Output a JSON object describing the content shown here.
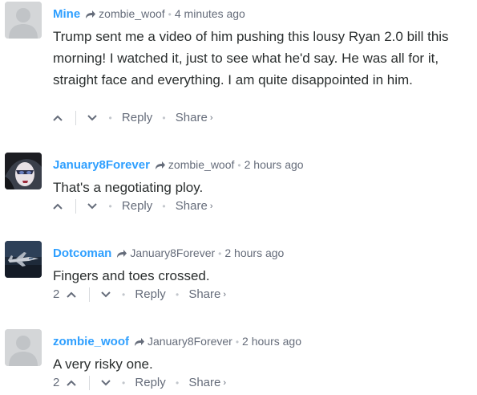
{
  "comments": [
    {
      "author": "Mine",
      "parent": "zombie_woof",
      "time": "4 minutes ago",
      "text": "Trump sent me a video of him pushing this lousy Ryan 2.0 bill this morning! I watched it, just to see what he'd say. He was all for it, straight face and everything. I am quite disappointed in him.",
      "upvotes": "",
      "reply_label": "Reply",
      "share_label": "Share",
      "share_chevron": "›",
      "avatar": "default-avatar"
    },
    {
      "author": "January8Forever",
      "parent": "zombie_woof",
      "time": "2 hours ago",
      "text": "That's a negotiating ploy.",
      "upvotes": "",
      "reply_label": "Reply",
      "share_label": "Share",
      "share_chevron": "›",
      "avatar": "face-paint-avatar"
    },
    {
      "author": "Dotcoman",
      "parent": "January8Forever",
      "time": "2 hours ago",
      "text": "Fingers and toes crossed.",
      "upvotes": "2",
      "reply_label": "Reply",
      "share_label": "Share",
      "share_chevron": "›",
      "avatar": "jet-avatar"
    },
    {
      "author": "zombie_woof",
      "parent": "January8Forever",
      "time": "2 hours ago",
      "text": "A very risky one.",
      "upvotes": "2",
      "reply_label": "Reply",
      "share_label": "Share",
      "share_chevron": "›",
      "avatar": "default-avatar"
    }
  ],
  "colors": {
    "author": "#2e9fff",
    "meta": "#656c7a",
    "text": "#2a2e2e",
    "separator": "#c2c6cc"
  }
}
